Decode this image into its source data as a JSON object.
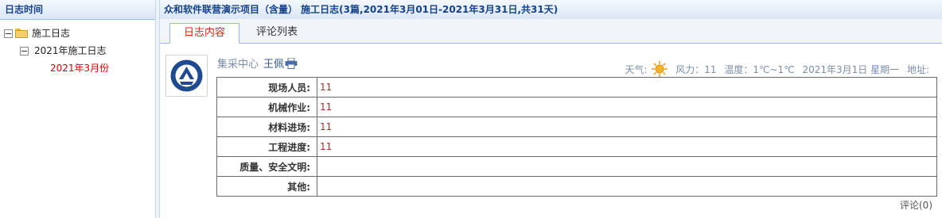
{
  "left_panel": {
    "title": "日志时间",
    "tree": {
      "root_label": "施工日志",
      "year_label": "2021年施工日志",
      "month_label": "2021年3月份"
    }
  },
  "right_panel": {
    "title": "众和软件联营演示项目（含量）  施工日志(3篇,2021年3月01日-2021年3月31日,共31天)",
    "tabs": [
      {
        "label": "日志内容",
        "active": true
      },
      {
        "label": "评论列表",
        "active": false
      }
    ],
    "entry": {
      "department": "集采中心",
      "author": "王佩",
      "weather_label": "天气:",
      "weather_icon": "sun-icon",
      "wind": "风力：11",
      "temperature": "温度：1℃~1℃",
      "date": "2021年3月1日 星期一",
      "location_label": "地址:"
    },
    "rows": [
      {
        "label": "现场人员:",
        "value": "11"
      },
      {
        "label": "机械作业:",
        "value": "11"
      },
      {
        "label": "材料进场:",
        "value": "11"
      },
      {
        "label": "工程进度:",
        "value": "11"
      },
      {
        "label": "质量、安全文明:",
        "value": ""
      },
      {
        "label": "其他:",
        "value": ""
      }
    ],
    "comments_link": "评论(0)"
  },
  "colors": {
    "header_text": "#15428b",
    "active_tab_text": "#e0231c",
    "tree_selected": "#e00000",
    "value_text": "#a0322a"
  }
}
